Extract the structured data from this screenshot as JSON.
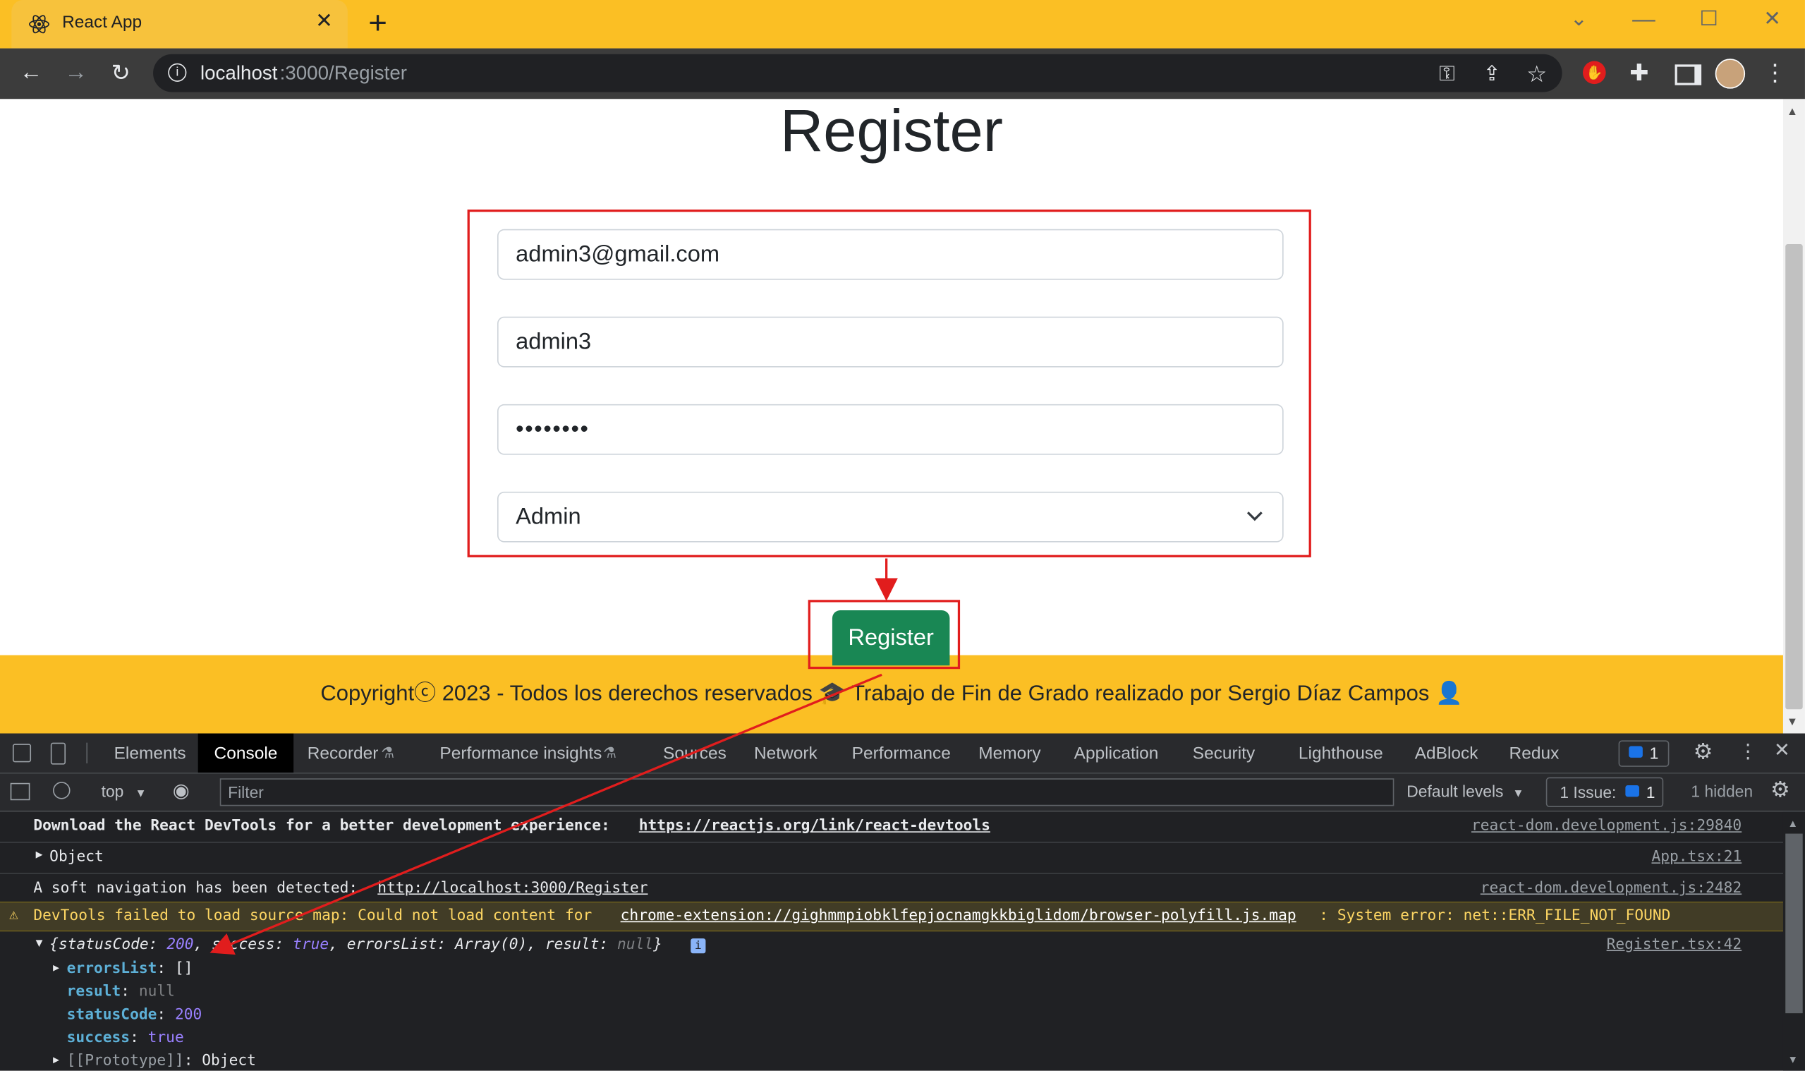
{
  "browser": {
    "tab_title": "React App",
    "url_host": "localhost",
    "url_rest": ":3000/Register"
  },
  "page": {
    "heading": "Register",
    "email_value": "admin3@gmail.com",
    "username_value": "admin3",
    "password_value": "••••••••",
    "role_selected": "Admin",
    "register_button": "Register",
    "footer_text": "Copyrightⓒ 2023 - Todos los derechos reservados 🎓 Trabajo de Fin de Grado realizado por Sergio Díaz Campos 👤"
  },
  "devtools": {
    "tabs": [
      "Elements",
      "Console",
      "Recorder",
      "Performance insights",
      "Sources",
      "Network",
      "Performance",
      "Memory",
      "Application",
      "Security",
      "Lighthouse",
      "AdBlock",
      "Redux"
    ],
    "issues_badge": "1",
    "context": "top",
    "filter_placeholder": "Filter",
    "levels": "Default levels",
    "issues_label": "1 Issue:",
    "issues_count": "1",
    "hidden_label": "1 hidden",
    "console": {
      "line1_text": "Download the React DevTools for a better development experience: ",
      "line1_link": "https://reactjs.org/link/react-devtools",
      "line1_src": "react-dom.development.js:29840",
      "line2_text": "Object",
      "line2_src": "App.tsx:21",
      "line3_text": "A soft navigation has been detected: ",
      "line3_link": "http://localhost:3000/Register",
      "line3_src": "react-dom.development.js:2482",
      "warn_text": "DevTools failed to load source map: Could not load content for ",
      "warn_link": "chrome-extension://gighmmpiobklfepjocnamgkkbiglidom/browser-polyfill.js.map",
      "warn_tail": ": System error: net::ERR_FILE_NOT_FOUND",
      "obj_summary_1": "{",
      "obj_k1": "statusCode",
      "obj_v1": "200",
      "obj_k2": "success",
      "obj_v2": "true",
      "obj_k3": "errorsList",
      "obj_v3": "Array(0)",
      "obj_k4": "result",
      "obj_v4": "null",
      "obj_src": "Register.tsx:42",
      "p_errorsList": "errorsList",
      "p_errorsList_v": "[]",
      "p_result": "result",
      "p_result_v": "null",
      "p_statusCode": "statusCode",
      "p_statusCode_v": "200",
      "p_success": "success",
      "p_success_v": "true",
      "p_proto": "[[Prototype]]",
      "p_proto_v": "Object"
    }
  },
  "colors": {
    "accent_yellow": "#fbbf24",
    "button_green": "#198754",
    "annotation_red": "#e11d1d"
  }
}
